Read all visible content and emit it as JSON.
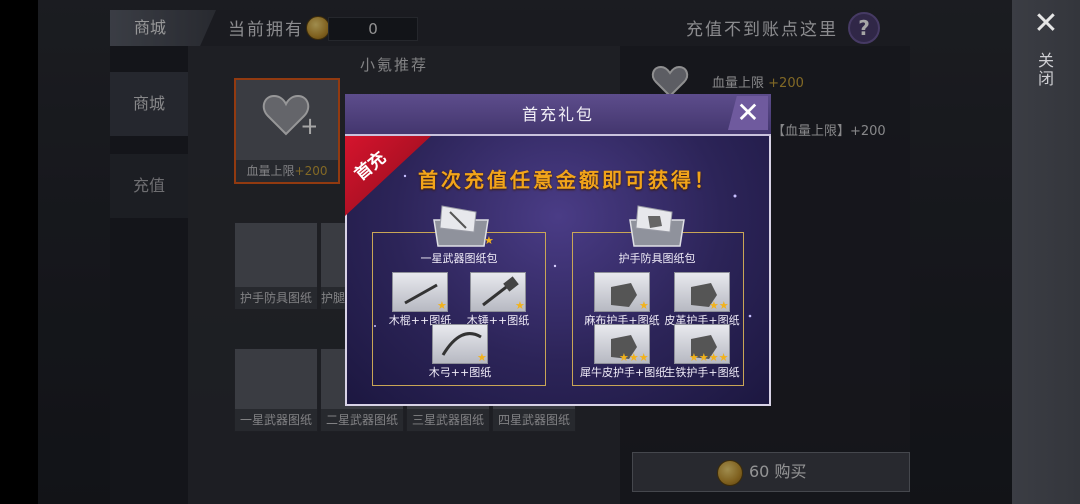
{
  "window": {
    "close_label": "关闭"
  },
  "topbar": {
    "tab_shop": "商城",
    "own_label": "当前拥有",
    "coin_amount": "0",
    "help_text": "充值不到账点这里",
    "help_icon": "?"
  },
  "sidebar": {
    "items": [
      {
        "label": "商城"
      },
      {
        "label": "充值"
      }
    ]
  },
  "shop": {
    "section_title": "小氪推荐",
    "featured": {
      "label": "血量上限",
      "bonus": "+200"
    },
    "row1": [
      {
        "label": "护手防具图纸"
      },
      {
        "label": "护腿"
      }
    ],
    "row2": [
      {
        "label": "一星武器图纸"
      },
      {
        "label": "二星武器图纸"
      },
      {
        "label": "三星武器图纸"
      },
      {
        "label": "四星武器图纸"
      }
    ]
  },
  "detail": {
    "label": "血量上限",
    "bonus": "+200",
    "effect_text": "【血量上限】+200",
    "buy_label": "60 购买"
  },
  "modal": {
    "title": "首充礼包",
    "ribbon": "首充",
    "headline": "首次充值任意金额即可获得！",
    "left_group": {
      "pack_label": "一星武器图纸包",
      "items": [
        {
          "label": "木棍++图纸"
        },
        {
          "label": "木锤++图纸"
        },
        {
          "label": "木弓++图纸"
        }
      ]
    },
    "right_group": {
      "pack_label": "护手防具图纸包",
      "items": [
        {
          "label": "麻布护手+图纸"
        },
        {
          "label": "皮革护手+图纸"
        },
        {
          "label": "犀牛皮护手+图纸"
        },
        {
          "label": "生铁护手+图纸"
        }
      ]
    }
  },
  "colors": {
    "accent_purple": "#5d4d8c",
    "headline_orange": "#f2a41a",
    "star_gold": "#f2b21c",
    "ribbon_red": "#d5142d",
    "bonus_gold": "#c8a13a"
  }
}
